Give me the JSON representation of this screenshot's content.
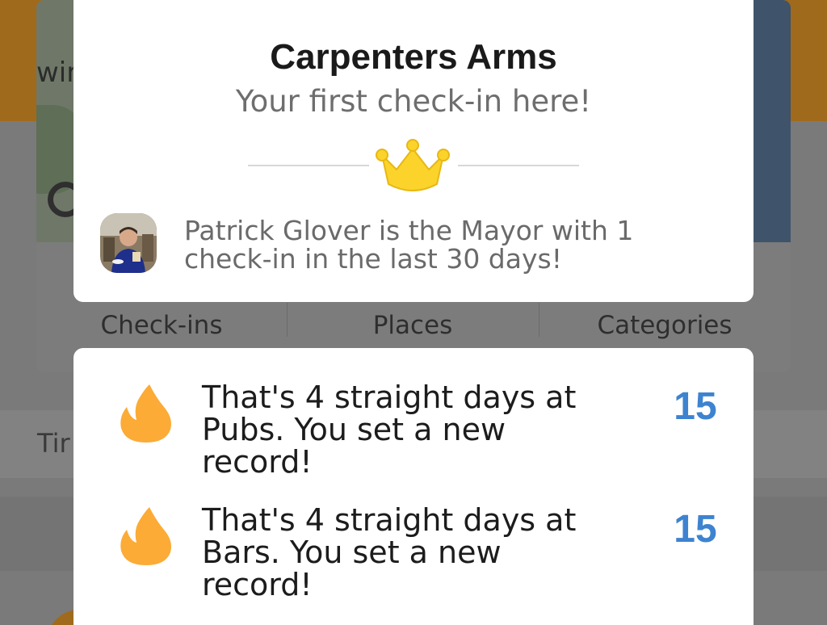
{
  "background": {
    "map_label_fragment": "win",
    "map_label_fragment_2": "c",
    "stats": [
      {
        "label": "Check-ins"
      },
      {
        "label": "Places"
      },
      {
        "label": "Categories"
      }
    ],
    "timeline_fragment": "Tir"
  },
  "mayor_card": {
    "venue_name": "Carpenters Arms",
    "subtitle": "Your first check-in here!",
    "crown_icon": "crown-icon",
    "mayor_message": "Patrick Glover is the Mayor with 1 check-in in the last 30 days!"
  },
  "streaks": [
    {
      "icon": "flame-icon",
      "text": "That's 4 straight days at Pubs. You set a new record!",
      "count": "15"
    },
    {
      "icon": "flame-icon",
      "text": "That's 4 straight days at Bars. You set a new record!",
      "count": "15"
    }
  ],
  "colors": {
    "crown_fill": "#fbd32b",
    "flame_fill": "#fbab36",
    "count_blue": "#3e83d0",
    "overlay": "#7a7a7a"
  }
}
